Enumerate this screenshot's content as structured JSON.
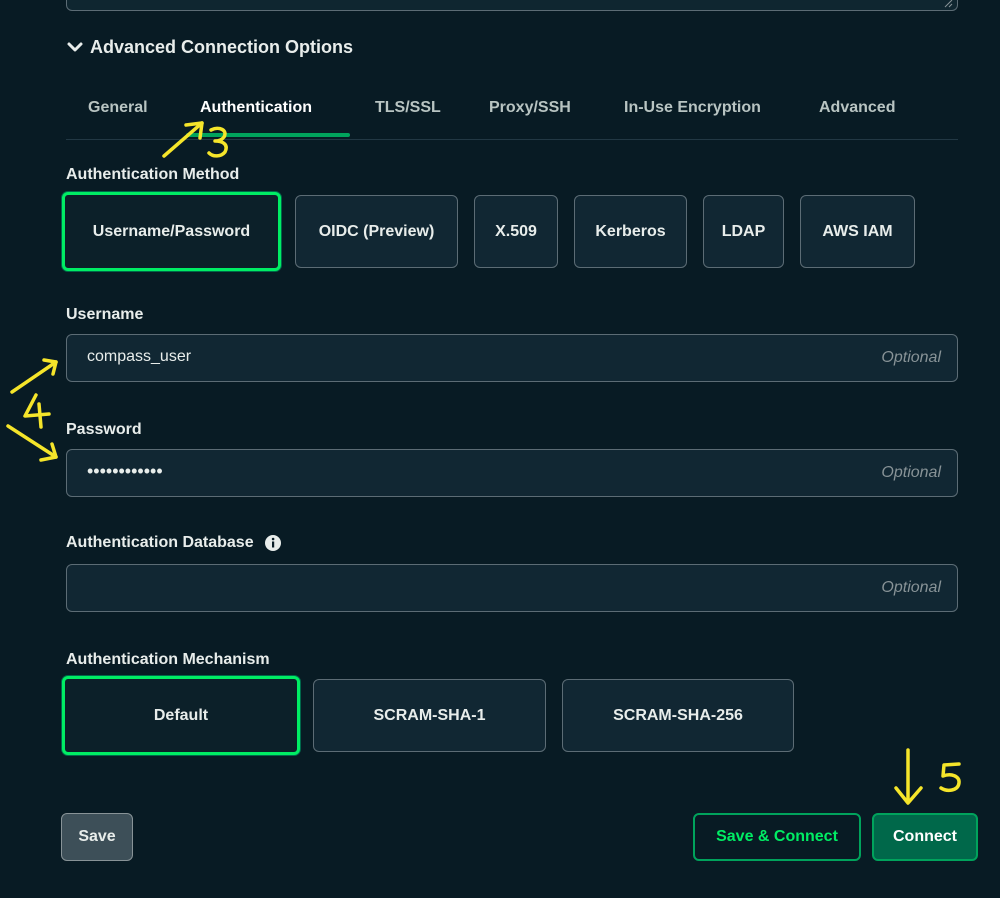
{
  "advanced": {
    "title": "Advanced Connection Options"
  },
  "tabs": [
    "General",
    "Authentication",
    "TLS/SSL",
    "Proxy/SSH",
    "In-Use Encryption",
    "Advanced"
  ],
  "auth_method": {
    "label": "Authentication Method",
    "options": [
      "Username/Password",
      "OIDC (Preview)",
      "X.509",
      "Kerberos",
      "LDAP",
      "AWS IAM"
    ],
    "selected": "Username/Password"
  },
  "username": {
    "label": "Username",
    "value": "compass_user",
    "placeholder": "Optional"
  },
  "password": {
    "label": "Password",
    "value": "••••••••••••",
    "placeholder": "Optional"
  },
  "auth_database": {
    "label": "Authentication Database",
    "value": "",
    "placeholder": "Optional"
  },
  "mechanism": {
    "label": "Authentication Mechanism",
    "options": [
      "Default",
      "SCRAM-SHA-1",
      "SCRAM-SHA-256"
    ],
    "selected": "Default"
  },
  "footer": {
    "save": "Save",
    "save_connect": "Save & Connect",
    "connect": "Connect"
  },
  "annotations": [
    "3",
    "4",
    "5"
  ],
  "colors": {
    "background": "#081b24",
    "accent": "#00ed64",
    "annotation": "#f5e52a"
  }
}
